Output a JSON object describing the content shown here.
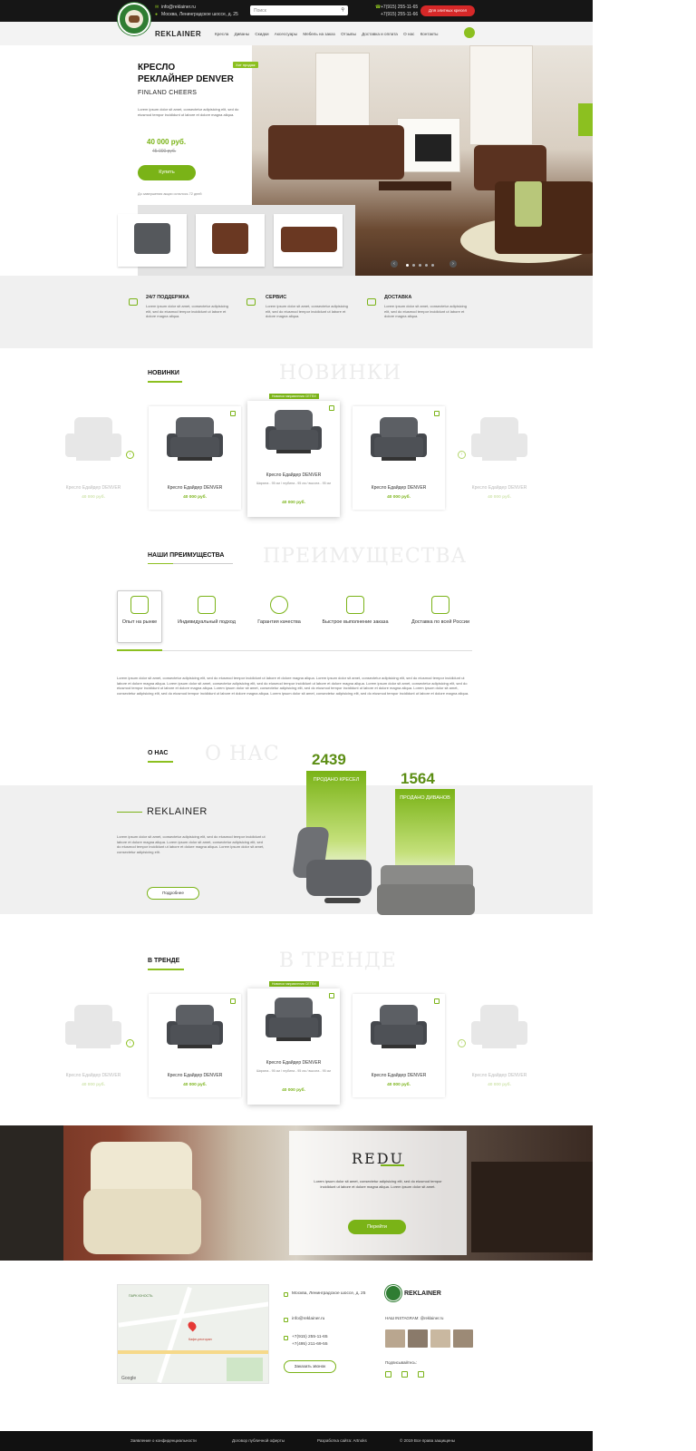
{
  "topbar": {
    "email": "info@reklainer.ru",
    "address": "Москва, Ленинградское шоссе, д. 25",
    "search_placeholder": "Поиск",
    "phone1": "+7(915) 255-11-65",
    "phone2": "+7(915) 255-11-66",
    "cta": "Для элитных кресел"
  },
  "nav": {
    "brand": "REKLAINER",
    "items": [
      "Кресла",
      "Диваны",
      "Скидки",
      "Аксессуары",
      "Мебель на заказ",
      "Отзывы",
      "Доставка и оплата",
      "О нас",
      "Контакты"
    ]
  },
  "hero": {
    "title_line1": "КРЕСЛО",
    "title_line2": "РЕКЛАЙНЕР DENVER",
    "subtitle": "FINLAND CHEERS",
    "badge": "Хит продаж",
    "description": "Lorem ipsum dolor sit amet, consectetur adipisicing elit, sed do eiusmod tempor incididunt ut labore et dolore magna aliqua.",
    "price": "40 000 руб.",
    "old_price": "45 000 руб.",
    "buy_label": "Купить",
    "note": "До завершения акции осталось 72 дней"
  },
  "features": [
    {
      "icon": "headset-icon",
      "title": "24/7 ПОДДЕРЖКА",
      "text": "Lorem ipsum dolor sit amet, consectetur adipisicing elit, sed do eiusmod tempor incididunt ut labore et dolore magna aliqua."
    },
    {
      "icon": "truck-icon",
      "title": "СЕРВИС",
      "text": "Lorem ipsum dolor sit amet, consectetur adipisicing elit, sed do eiusmod tempor incididunt ut labore et dolore magna aliqua."
    },
    {
      "icon": "box-icon",
      "title": "ДОСТАВКА",
      "text": "Lorem ipsum dolor sit amet, consectetur adipisicing elit, sed do eiusmod tempor incididunt ut labore et dolore magna aliqua."
    }
  ],
  "novelties": {
    "title": "НОВИНКИ",
    "ghost": "НОВИНКИ",
    "badge": "Новинки направления СЕТЕИ",
    "cards": [
      {
        "name": "Кресло Едайдер DENVER",
        "price": "40 000 руб."
      },
      {
        "name": "Кресло Едайдер DENVER",
        "price": "40 000 руб."
      },
      {
        "name": "Кресло Едайдер DENVER",
        "price": "40 000 руб.",
        "desc": "Ширина - 95 см / глубина - 95 см / высота - 95 см"
      },
      {
        "name": "Кресло Едайдер DENVER",
        "price": "40 000 руб."
      },
      {
        "name": "Кресло Едайдер DENVER",
        "price": "40 000 руб."
      }
    ]
  },
  "advantages": {
    "title": "НАШИ ПРЕИМУЩЕСТВА",
    "ghost": "ПРЕИМУЩЕСТВА",
    "items": [
      {
        "icon": "laurel-icon",
        "label": "Опыт на рынке"
      },
      {
        "icon": "person-icon",
        "label": "Индивидуальный подход"
      },
      {
        "icon": "thumbs-up-icon",
        "label": "Гарантия качества"
      },
      {
        "icon": "fast-box-icon",
        "label": "Быстрое выполнение заказа"
      },
      {
        "icon": "delivery-truck-icon",
        "label": "Доставка по всей России"
      }
    ],
    "text": "Lorem ipsum dolor sit amet, consectetur adipisicing elit, sed do eiusmod tempor incididunt ut labore et dolore magna aliqua. Lorem ipsum dolor sit amet, consectetur adipisicing elit, sed do eiusmod tempor incididunt ut labore et dolore magna aliqua. Lorem ipsum dolor sit amet, consectetur adipisicing elit, sed do eiusmod tempor incididunt ut labore et dolore magna aliqua. Lorem ipsum dolor sit amet, consectetur adipisicing elit, sed do eiusmod tempor incididunt ut labore et dolore magna aliqua. Lorem ipsum dolor sit amet, consectetur adipisicing elit, sed do eiusmod tempor incididunt ut labore et dolore magna aliqua. Lorem ipsum dolor sit amet, consectetur adipisicing elit, sed do eiusmod tempor incididunt ut labore et dolore magna aliqua. Lorem ipsum dolor sit amet, consectetur adipisicing elit, sed do eiusmod tempor incididunt ut labore et dolore magna aliqua."
  },
  "about": {
    "title": "О НАС",
    "ghost": "О НАС",
    "brand": "REKLAINER",
    "text": "Lorem ipsum dolor sit amet, consectetur adipisicing elit, sed do eiusmod tempor incididunt ut labore et dolore magna aliqua. Lorem ipsum dolor sit amet, consectetur adipisicing elit, sed do eiusmod tempor incididunt ut labore et dolore magna aliqua. Lorem ipsum dolor sit amet, consectetur adipisicing elit.",
    "more": "Подробнее",
    "stat1_num": "2439",
    "stat1_label": "ПРОДАНО КРЕСЕЛ",
    "stat2_num": "1564",
    "stat2_label": "ПРОДАНО ДИВАНОВ"
  },
  "trend": {
    "title": "В ТРЕНДЕ",
    "ghost": "В ТРЕНДЕ",
    "badge": "Новинки направления СЕТЕИ",
    "cards": [
      {
        "name": "Кресло Едайдер DENVER",
        "price": "40 000 руб."
      },
      {
        "name": "Кресло Едайдер DENVER",
        "price": "40 000 руб."
      },
      {
        "name": "Кресло Едайдер DENVER",
        "price": "40 000 руб.",
        "desc": "Ширина - 95 см / глубина - 95 см / высота - 95 см"
      },
      {
        "name": "Кресло Едайдер DENVER",
        "price": "40 000 руб."
      },
      {
        "name": "Кресло Едайдер DENVER",
        "price": "40 000 руб."
      }
    ]
  },
  "redu": {
    "title": "REDU",
    "text": "Lorem ipsum dolor sit amet, consectetur adipisicing elit, sed do eiusmod tempor incididunt ut labore et dolore magna aliqua. Lorem ipsum dolor sit amet.",
    "button": "Перейти"
  },
  "footer": {
    "address": "Москва, Ленинградское шоссе, д. 25",
    "email": "info@reklainer.ru",
    "phone1": "+7(915) 255-11-65",
    "phone2": "+7(495) 211-69-55",
    "callback": "Заказать звонок",
    "brand": "REKLAINER",
    "instagram": "НАШ INSTAGRAM: @reklainer.ru",
    "subscribe": "Подписывайтесь:",
    "map_labels": [
      "ПАРК ЮНОСТЬ",
      "Кафе-ресторан",
      "Google"
    ]
  },
  "bottom": {
    "privacy": "Заявление о конфиденциальности",
    "offer": "Договор публичной оферты",
    "dev": "Разработка сайта: Artnoks",
    "copy": "© 2019 Все права защищены"
  },
  "colors": {
    "accent": "#7ab317",
    "topbar": "#161616",
    "cta": "#d62828"
  }
}
